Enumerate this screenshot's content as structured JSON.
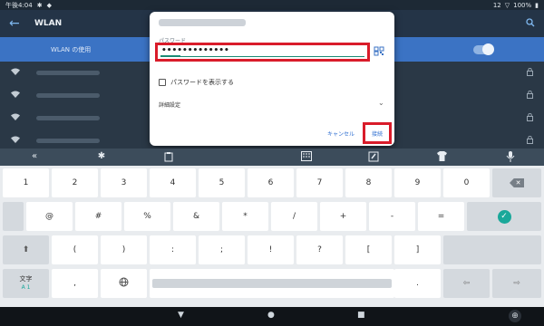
{
  "status_bar": {
    "time": "午後4:04",
    "icons": [
      "gear-icon",
      "shield-icon"
    ],
    "notification_count": "12",
    "battery": "100%"
  },
  "app_bar": {
    "title": "WLAN",
    "back_icon": "arrow-left-icon",
    "search_icon": "search-icon"
  },
  "wlan_toggle": {
    "label": "WLAN の使用",
    "state": "on"
  },
  "network_rows": [
    {
      "icon": "wifi-icon",
      "lock_icon": "lock-icon"
    },
    {
      "icon": "wifi-icon",
      "lock_icon": "lock-icon"
    },
    {
      "icon": "wifi-icon",
      "lock_icon": "lock-icon"
    },
    {
      "icon": "wifi-icon",
      "lock_icon": "lock-icon"
    }
  ],
  "dialog": {
    "password_label": "パスワード",
    "password_value": "•••••••••••••",
    "show_password_label": "パスワードを表示する",
    "show_password_checked": false,
    "advanced_label": "詳細設定",
    "cancel_label": "キャンセル",
    "connect_label": "接続",
    "highlight_color": "#d91c2a"
  },
  "keyboard": {
    "toolbar_icons": [
      "double-chevron-left-icon",
      "gear-icon",
      "clipboard-icon",
      "keyboard-grid-icon",
      "edit-note-icon",
      "shirt-icon",
      "microphone-icon"
    ],
    "row1": [
      "1",
      "2",
      "3",
      "4",
      "5",
      "6",
      "7",
      "8",
      "9",
      "0"
    ],
    "row2": [
      "@",
      "#",
      "%",
      "&",
      "*",
      "/",
      "+",
      "-",
      "="
    ],
    "row3": [
      "(",
      ")",
      ":",
      ";",
      "!",
      "?",
      "[",
      "]"
    ],
    "row4_comma": ",",
    "row4_period": ".",
    "moji_label": "文字",
    "moji_sub": "A 1",
    "enter_color": "#1aa89a"
  },
  "nav_bar": {
    "icons": [
      "back-triangle-icon",
      "home-circle-icon",
      "recents-square-icon",
      "globe-icon"
    ]
  }
}
